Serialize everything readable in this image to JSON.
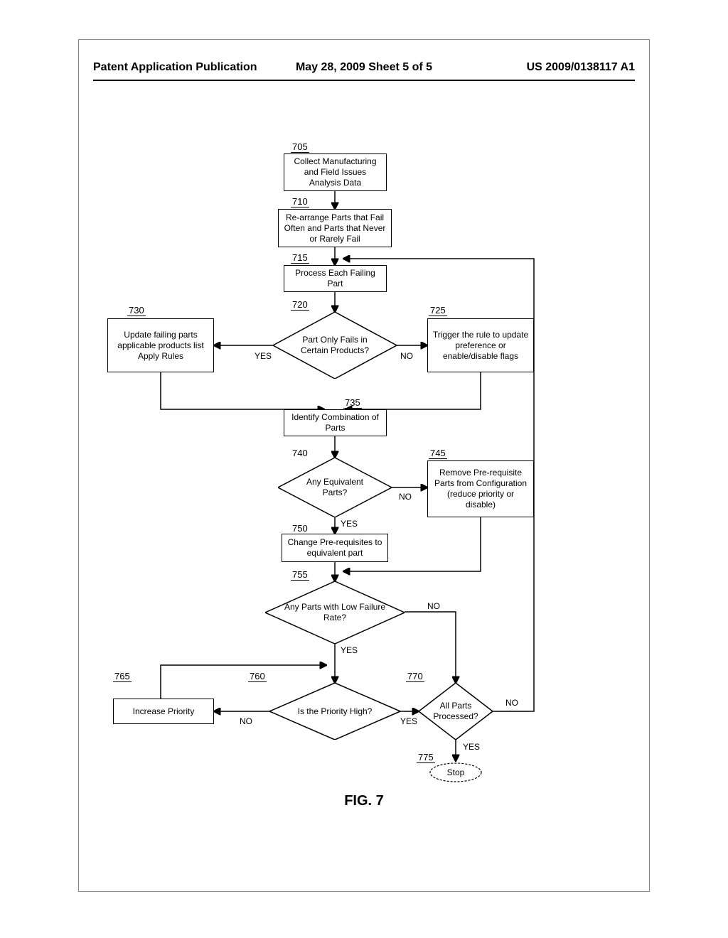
{
  "header": {
    "left": "Patent Application Publication",
    "center": "May 28, 2009  Sheet 5 of 5",
    "right": "US 2009/0138117 A1"
  },
  "figure_label": "FIG. 7",
  "nodes": {
    "n705": {
      "ref": "705",
      "text": "Collect Manufacturing and Field Issues Analysis Data"
    },
    "n710": {
      "ref": "710",
      "text": "Re-arrange Parts that Fail Often and Parts that Never or Rarely Fail"
    },
    "n715": {
      "ref": "715",
      "text": "Process Each Failing Part"
    },
    "n720": {
      "ref": "720",
      "text": "Part Only Fails in Certain Products?"
    },
    "n725": {
      "ref": "725",
      "text": "Trigger the rule to update preference or enable/disable flags"
    },
    "n730": {
      "ref": "730",
      "text": "Update failing parts applicable products list\nApply Rules"
    },
    "n735": {
      "ref": "735",
      "text": "Identify Combination of Parts"
    },
    "n740": {
      "ref": "740",
      "text": "Any Equivalent Parts?"
    },
    "n745": {
      "ref": "745",
      "text": "Remove Pre-requisite Parts from Configuration (reduce priority or disable)"
    },
    "n750": {
      "ref": "750",
      "text": "Change Pre-requisites to equivalent part"
    },
    "n755": {
      "ref": "755",
      "text": "Any Parts with Low Failure Rate?"
    },
    "n760": {
      "ref": "760",
      "text": "Is the Priority High?"
    },
    "n765": {
      "ref": "765",
      "text": "Increase Priority"
    },
    "n770": {
      "ref": "770",
      "text": "All Parts Processed?"
    },
    "n775": {
      "ref": "775",
      "text": "Stop"
    }
  },
  "labels": {
    "yes": "YES",
    "no": "NO"
  }
}
